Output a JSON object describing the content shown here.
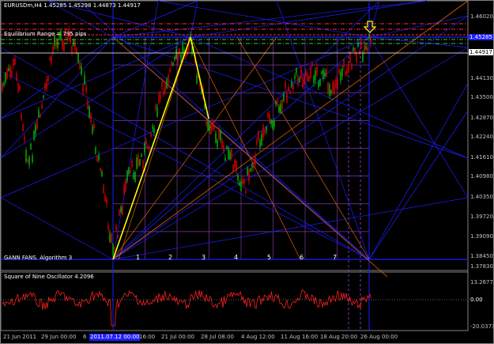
{
  "header": {
    "symbol_info": "EURUSDm,H4  1.45285 1.45298 1.44873 1.44917"
  },
  "overlays": {
    "range_label": "Equilibrium Range = 795 pips",
    "gann_label": "GANN FANS. Algorithm 3",
    "gann_numbers": [
      "1",
      "2",
      "3",
      "4",
      "5",
      "6",
      "7"
    ]
  },
  "price_axis": {
    "labels": [
      "1.46020",
      "1.44917",
      "1.44130",
      "1.43500",
      "1.42870",
      "1.42240",
      "1.41610",
      "1.40980",
      "1.40350",
      "1.39720",
      "1.39090",
      "1.38450",
      "1.37830"
    ],
    "current_price_box": "1.44917",
    "top_level_box": "1.45285"
  },
  "oscillator": {
    "title": "Square of Nine Oscillator 4.2096",
    "axis_labels": [
      "13.2677",
      "0.00",
      "-20.0373"
    ]
  },
  "time_axis": {
    "labels": [
      "21 Jun 2011",
      "29 Jun 00:00",
      "6",
      "2011.07.12 00:00",
      "16:00",
      "21 Jul 00:00",
      "28 Jul 08:00",
      "4 Aug 12:00",
      "11 Aug 16:00",
      "18 Aug 20:00",
      "26 Aug 00:00"
    ],
    "highlighted_label": "2011.07.12 00:00"
  },
  "colors": {
    "up_candle": "#00c000",
    "down_candle": "#e00000",
    "fan_blue": "#1e1eff",
    "fan_orange": "#e06000",
    "zigzag": "#ffff00",
    "oscillator_line": "#ff2020",
    "range_red": "#ff3030",
    "range_green": "#40c040",
    "arrow": "#ffff00"
  },
  "icons": {
    "arrow_marker": "down-arrow-icon"
  }
}
